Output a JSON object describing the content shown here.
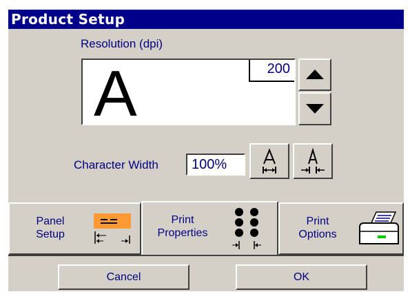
{
  "window": {
    "title": "Product Setup"
  },
  "resolution": {
    "label": "Resolution (dpi)",
    "preview_glyph": "A",
    "value": "200",
    "up_icon": "arrow-up-icon",
    "down_icon": "arrow-down-icon"
  },
  "character_width": {
    "label": "Character Width",
    "value": "100%",
    "widen_icon": "letter-widen-icon",
    "narrow_icon": "letter-narrow-icon"
  },
  "tabs": [
    {
      "label_line1": "Panel",
      "label_line2": "Setup",
      "icon": "panel-setup-icon",
      "active": false
    },
    {
      "label_line1": "Print",
      "label_line2": "Properties",
      "icon": "dot-matrix-icon",
      "active": true
    },
    {
      "label_line1": "Print",
      "label_line2": "Options",
      "icon": "printer-icon",
      "active": false
    }
  ],
  "buttons": {
    "cancel": "Cancel",
    "ok": "OK"
  },
  "colors": {
    "title_bar": "#00008b",
    "label_text": "#000080",
    "face": "#d4d0c8",
    "accent_orange": "#ff9933",
    "indicator_green": "#00cc00"
  }
}
